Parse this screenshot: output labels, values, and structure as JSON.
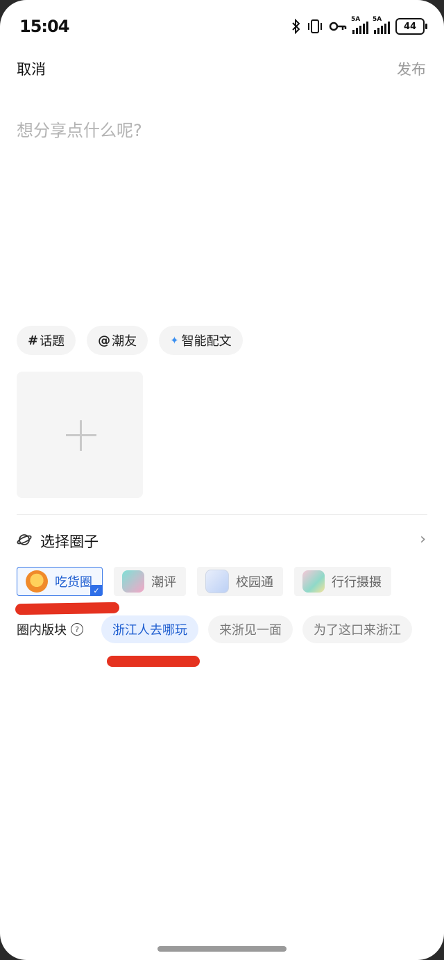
{
  "status_bar": {
    "time": "15:04",
    "signal1_label": "5A",
    "signal2_label": "5A",
    "battery": "44"
  },
  "header": {
    "cancel_label": "取消",
    "publish_label": "发布"
  },
  "composer": {
    "placeholder": "想分享点什么呢?"
  },
  "chips": [
    {
      "prefix": "#",
      "label": "话题"
    },
    {
      "prefix": "@",
      "label": "潮友"
    },
    {
      "prefix": "",
      "label": "智能配文"
    }
  ],
  "circle": {
    "title": "选择圈子"
  },
  "circle_cards": [
    {
      "label": "吃货圈",
      "selected": true
    },
    {
      "label": "潮评",
      "selected": false
    },
    {
      "label": "校园通",
      "selected": false
    },
    {
      "label": "行行摄摄",
      "selected": false
    }
  ],
  "sections": {
    "label": "圈内版块",
    "items": [
      {
        "label": "浙江人去哪玩",
        "selected": true
      },
      {
        "label": "来浙见一面",
        "selected": false
      },
      {
        "label": "为了这口来浙江",
        "selected": false
      }
    ]
  },
  "colors": {
    "accent": "#2f6fe8",
    "marker": "#e5321f"
  }
}
